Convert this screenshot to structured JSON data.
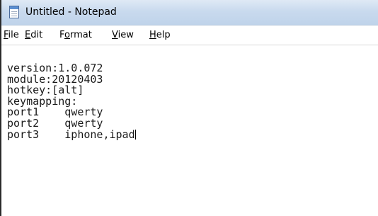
{
  "window": {
    "title": "Untitled - Notepad"
  },
  "menu": {
    "file_mn": "F",
    "file_rest": "ile",
    "edit_mn": "E",
    "edit_rest": "dit",
    "format_pre": "F",
    "format_mn": "o",
    "format_rest": "rmat",
    "view_mn": "V",
    "view_rest": "iew",
    "help_mn": "H",
    "help_rest": "elp"
  },
  "editor": {
    "lines": [
      "version:1.0.072",
      "module:20120403",
      "hotkey:[alt]",
      "keymapping:",
      "port1    qwerty",
      "port2    qwerty",
      "port3    iphone,ipad"
    ]
  },
  "icons": {
    "app": "notepad-icon"
  }
}
